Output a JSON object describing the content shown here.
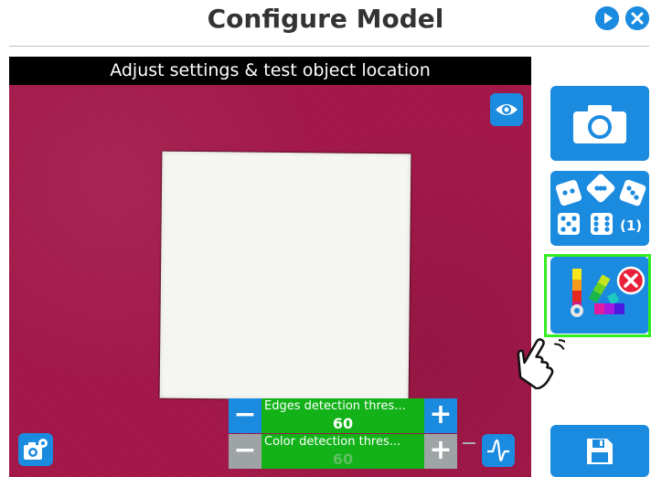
{
  "header": {
    "title": "Configure Model",
    "play_icon": "play-icon",
    "close_icon": "close-icon"
  },
  "viewer": {
    "banner": "Adjust settings & test object location",
    "eye_icon": "eye-icon",
    "camera_settings_icon": "camera-settings-icon",
    "signal_icon": "signal-icon"
  },
  "sliders": [
    {
      "label": "Edges detection thres...",
      "value": "60",
      "fill_fraction": 1.0,
      "enabled": true
    },
    {
      "label": "Color detection thres...",
      "value": "60",
      "fill_fraction": 1.0,
      "enabled": false
    }
  ],
  "sidebar": {
    "snapshot_icon": "camera-icon",
    "multiple_views_icon": "dice-icon",
    "multiple_views_count": "(1)",
    "color_icon": "color-palette-icon",
    "remove_icon": "remove-icon",
    "save_icon": "save-icon"
  },
  "colors": {
    "accent": "#1b8be0",
    "fill_green": "#12b218",
    "highlight": "#33ee22",
    "background_surface": "#a21648",
    "danger": "#e8203a"
  }
}
